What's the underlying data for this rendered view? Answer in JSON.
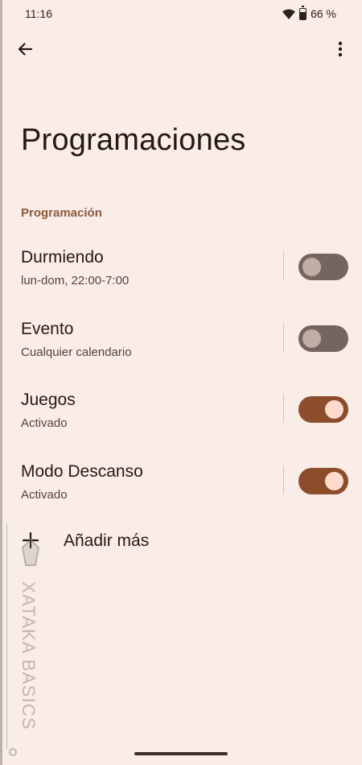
{
  "status_bar": {
    "time": "11:16",
    "battery": "66 %"
  },
  "header": {
    "back_icon": "arrow-back-icon",
    "more_icon": "more-vert-icon"
  },
  "page": {
    "title": "Programaciones",
    "section_title": "Programación"
  },
  "schedules": [
    {
      "title": "Durmiendo",
      "subtitle": "lun-dom, 22:00-7:00",
      "enabled": false
    },
    {
      "title": "Evento",
      "subtitle": "Cualquier calendario",
      "enabled": false
    },
    {
      "title": "Juegos",
      "subtitle": "Activado",
      "enabled": true
    },
    {
      "title": "Modo Descanso",
      "subtitle": "Activado",
      "enabled": true
    }
  ],
  "add_more": {
    "label": "Añadir más",
    "icon": "plus-icon"
  },
  "watermark": {
    "text": "XATAKA BASICS"
  },
  "colors": {
    "background": "#faece7",
    "accent": "#8c4d2c",
    "section": "#8b5a3c"
  }
}
